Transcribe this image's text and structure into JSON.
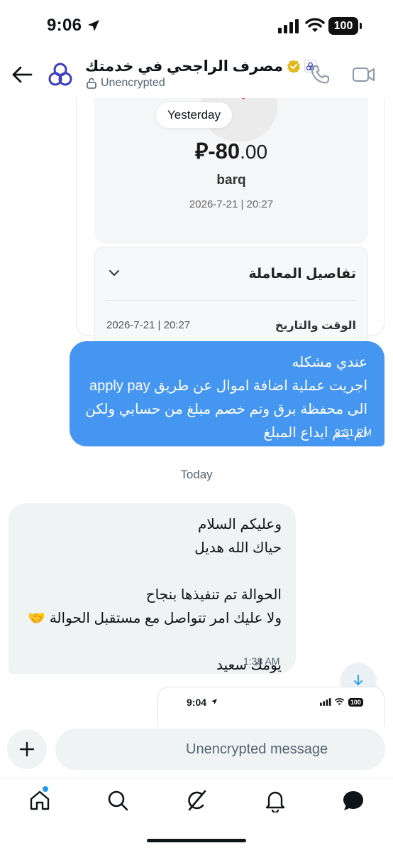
{
  "status_bar": {
    "time": "9:06",
    "battery": "100"
  },
  "header": {
    "title": "مصرف الراجحي في خدمتك",
    "encryption_label": "Unencrypted"
  },
  "receipt": {
    "amount_int": "-80",
    "amount_dec": ".00",
    "currency_symbol": "⃁",
    "merchant": "barq",
    "date": "2026-7-21 | 20:27",
    "details_title": "تفاصيل المعاملة",
    "datetime_label": "الوقت والتاريخ",
    "datetime_value": "2026-7-21 | 20:27"
  },
  "chat": {
    "yesterday_label": "Yesterday",
    "today_label": "Today",
    "messages": [
      {
        "direction": "outgoing",
        "lines": [
          "عندي مشكله",
          "اجريت عملية اضافة اموال عن طريق apply pay",
          "الى محفظة برق وتم خصم مبلغ من حسابي ولكن",
          "لم يتم ايداع المبلغ"
        ],
        "time": "9:31 PM"
      },
      {
        "direction": "incoming",
        "lines": [
          "وعليكم السلام",
          "حياك الله هديل",
          "",
          "الحوالة تم تنفيذها بنجاح",
          "ولا عليك امر تتواصل مع مستقبل الحوالة 🤝",
          "",
          "يومك سعيد"
        ],
        "time": "1:38 AM"
      }
    ],
    "preview": {
      "time": "9:04",
      "battery": "100"
    }
  },
  "composer": {
    "placeholder": "Unencrypted message"
  },
  "icons": {
    "back": "back-arrow-icon",
    "avatar": "alrajhi-logo-icon",
    "verified": "gold-verified-badge-icon",
    "call": "phone-icon",
    "video": "video-camera-icon",
    "add": "plus-icon",
    "scroll_down": "arrow-down-icon",
    "tabs": [
      "home-icon",
      "search-icon",
      "grok-icon",
      "bell-icon",
      "messages-icon"
    ]
  },
  "colors": {
    "outgoing_bubble": "#4596f0",
    "incoming_bubble": "#eff3f4",
    "accent": "#1d9bf0",
    "verified_gold": "#e2b719",
    "brand_indigo": "#3d3dbd",
    "debit_arrow": "#ea4b4b"
  }
}
